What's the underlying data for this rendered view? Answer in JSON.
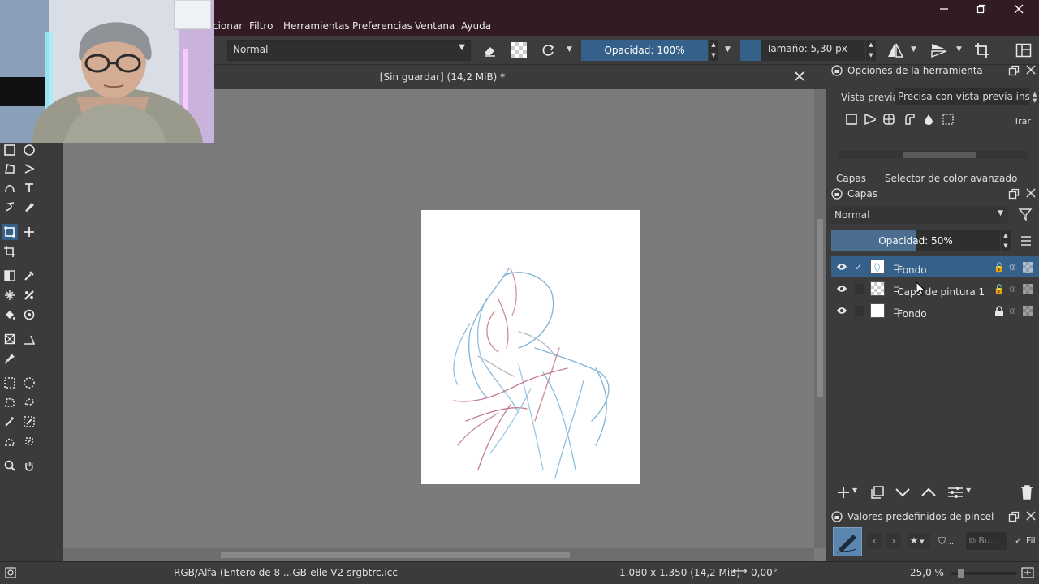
{
  "menu": {
    "items": [
      "cionar",
      "Filtro",
      "Herramientas",
      "Preferencias",
      "Ventana",
      "Ayuda"
    ]
  },
  "toolbar": {
    "blend_mode": "Normal",
    "opacity": "Opacidad: 100%",
    "size": "Tamaño: 5,30 px"
  },
  "document": {
    "title": "[Sin guardar]  (14,2 MiB) *"
  },
  "tool_options": {
    "title": "Opciones de la herramienta",
    "preview_label": "Vista previa",
    "preview_value": "Precisa con vista previa instantá",
    "trans_label": "Trar"
  },
  "docker_tabs": [
    "Capas",
    "Selector de color avanzado"
  ],
  "layers": {
    "title": "Capas",
    "blend_mode": "Normal",
    "opacity_label": "Opacidad:  50%",
    "opacity_value": 50,
    "items": [
      {
        "name": "Fondo",
        "selected": true,
        "checked": true,
        "locked": false
      },
      {
        "name": "Capa de pintura 1",
        "selected": false,
        "checked": false,
        "locked": false
      },
      {
        "name": "Fondo",
        "selected": false,
        "checked": false,
        "locked": true
      }
    ]
  },
  "brush_presets": {
    "title": "Valores predefinidos de pincel",
    "search_placeholder": "Bu...",
    "filter_label": "Fil"
  },
  "status": {
    "color_space": "RGB/Alfa (Entero de 8 ...GB-elle-V2-srgbtrc.icc",
    "dimensions": "1.080 x 1.350 (14,2 MiB)",
    "rotation": "0,00°",
    "zoom": "25,0 %"
  },
  "colors": {
    "accent": "#35608a",
    "titlebar": "#321b25",
    "canvas_bg": "#7b7b7b",
    "panel_bg": "#3b3b3b"
  }
}
